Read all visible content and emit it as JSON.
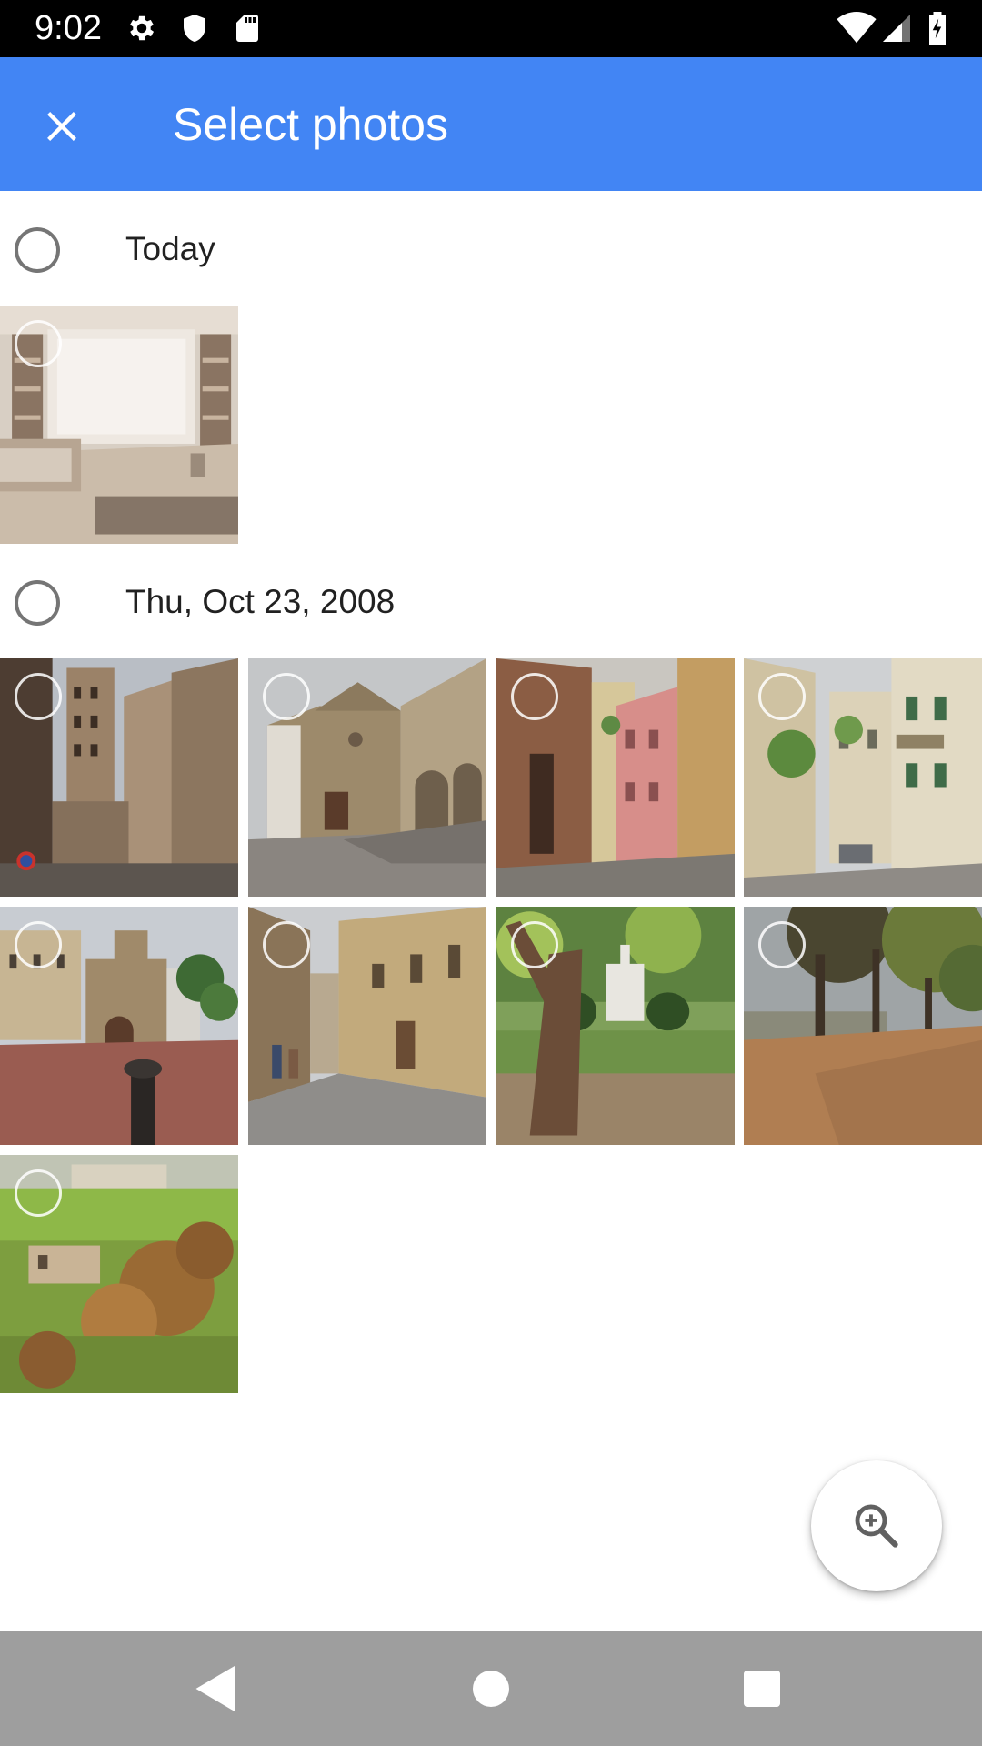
{
  "status_bar": {
    "time": "9:02",
    "icons": [
      "gear-icon",
      "shield-icon",
      "sd-card-icon",
      "wifi-icon",
      "cell-signal-icon",
      "battery-charging-icon"
    ]
  },
  "app_bar": {
    "title": "Select photos",
    "close_icon": "close-icon",
    "background_color": "#4285f4"
  },
  "sections": [
    {
      "label": "Today",
      "photos": [
        {
          "subject": "living room interior with window and bookshelves"
        }
      ]
    },
    {
      "label": "Thu, Oct 23, 2008",
      "photos": [
        {
          "subject": "stone bell tower on old town street"
        },
        {
          "subject": "stone church facade with arcade and steps"
        },
        {
          "subject": "narrow street with pink building"
        },
        {
          "subject": "narrow street with parked car and green shutters"
        },
        {
          "subject": "brick piazza with church and bollard"
        },
        {
          "subject": "narrow street with walking people"
        },
        {
          "subject": "park with tree trunk and white monument"
        },
        {
          "subject": "tree lined avenue with fallen leaves"
        },
        {
          "subject": "green hillside with houses and autumn tree"
        }
      ]
    }
  ],
  "fab": {
    "icon": "zoom-in-icon"
  },
  "nav_bar": {
    "icons": [
      "back-icon",
      "home-icon",
      "recents-icon"
    ]
  }
}
